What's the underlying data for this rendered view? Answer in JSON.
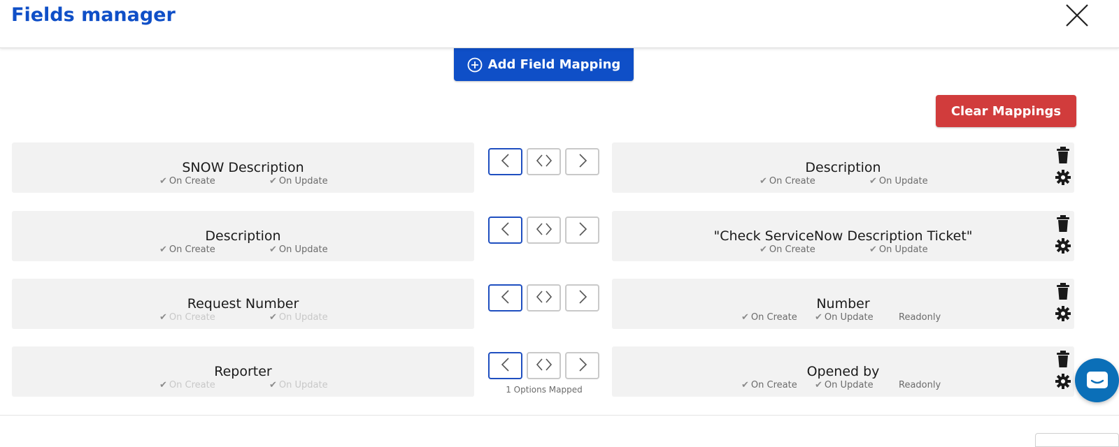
{
  "header": {
    "title": "Fields manager"
  },
  "toolbar": {
    "add_label": "Add Field Mapping",
    "clear_label": "Clear Mappings"
  },
  "colors": {
    "brand": "#0f4fc7",
    "danger": "#d13c3c",
    "panel": "#f2f2f2",
    "chat": "#0b6fb8"
  },
  "mappings": [
    {
      "left": {
        "name": "SNOW Description",
        "on_create": "On Create",
        "on_update": "On Update",
        "enabled": true
      },
      "right": {
        "name": "Description",
        "on_create": "On Create",
        "on_update": "On Update",
        "readonly": ""
      },
      "direction": "left",
      "note": ""
    },
    {
      "left": {
        "name": "Description",
        "on_create": "On Create",
        "on_update": "On Update",
        "enabled": true
      },
      "right": {
        "name": "\"Check ServiceNow Description Ticket\"",
        "on_create": "On Create",
        "on_update": "On Update",
        "readonly": ""
      },
      "direction": "left",
      "note": ""
    },
    {
      "left": {
        "name": "Request Number",
        "on_create": "On Create",
        "on_update": "On Update",
        "enabled": false
      },
      "right": {
        "name": "Number",
        "on_create": "On Create",
        "on_update": "On Update",
        "readonly": "Readonly"
      },
      "direction": "left",
      "note": ""
    },
    {
      "left": {
        "name": "Reporter",
        "on_create": "On Create",
        "on_update": "On Update",
        "enabled": false
      },
      "right": {
        "name": "Opened by",
        "on_create": "On Create",
        "on_update": "On Update",
        "readonly": "Readonly"
      },
      "direction": "left",
      "note": "1 Options Mapped"
    }
  ],
  "icons": {
    "close": "close-icon",
    "add": "plus-circle-icon",
    "trash": "trash-icon",
    "gear": "gear-icon",
    "chat": "chat-icon"
  }
}
